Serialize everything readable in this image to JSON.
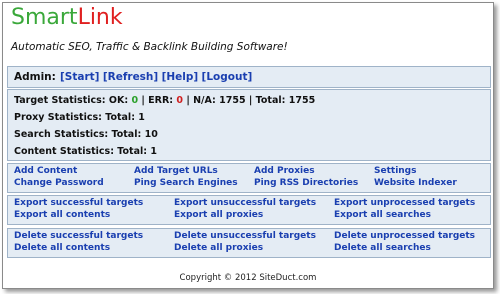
{
  "header": {
    "logo_part1": "Smart",
    "logo_part2": "Link",
    "tagline": "Automatic SEO, Traffic & Backlink Building Software!"
  },
  "admin": {
    "label": "Admin:",
    "links": [
      "[Start]",
      "[Refresh]",
      "[Help]",
      "[Logout]"
    ]
  },
  "stats": {
    "target_prefix": "Target Statistics: OK:",
    "ok": "0",
    "err_label": "| ERR:",
    "err": "0",
    "rest": "| N/A: 1755 | Total: 1755",
    "proxy": "Proxy Statistics: Total: 1",
    "search": "Search Statistics: Total: 10",
    "content": "Content Statistics: Total: 1"
  },
  "menu": {
    "add_content": "Add Content",
    "change_password": "Change Password",
    "add_target_urls": "Add Target URLs",
    "ping_search_engines": "Ping Search Engines",
    "add_proxies": "Add Proxies",
    "ping_rss_directories": "Ping RSS Directories",
    "settings": "Settings",
    "website_indexer": "Website Indexer"
  },
  "export": {
    "successful_targets": "Export successful targets",
    "all_contents": "Export all contents",
    "unsuccessful_targets": "Export unsuccessful targets",
    "all_proxies": "Export all proxies",
    "unprocessed_targets": "Export unprocessed targets",
    "all_searches": "Export all searches"
  },
  "delete": {
    "successful_targets": "Delete successful targets",
    "all_contents": "Delete all contents",
    "unsuccessful_targets": "Delete unsuccessful targets",
    "all_proxies": "Delete all proxies",
    "unprocessed_targets": "Delete unprocessed targets",
    "all_searches": "Delete all searches"
  },
  "footer": {
    "copyright": "Copyright © 2012 SiteDuct.com"
  }
}
